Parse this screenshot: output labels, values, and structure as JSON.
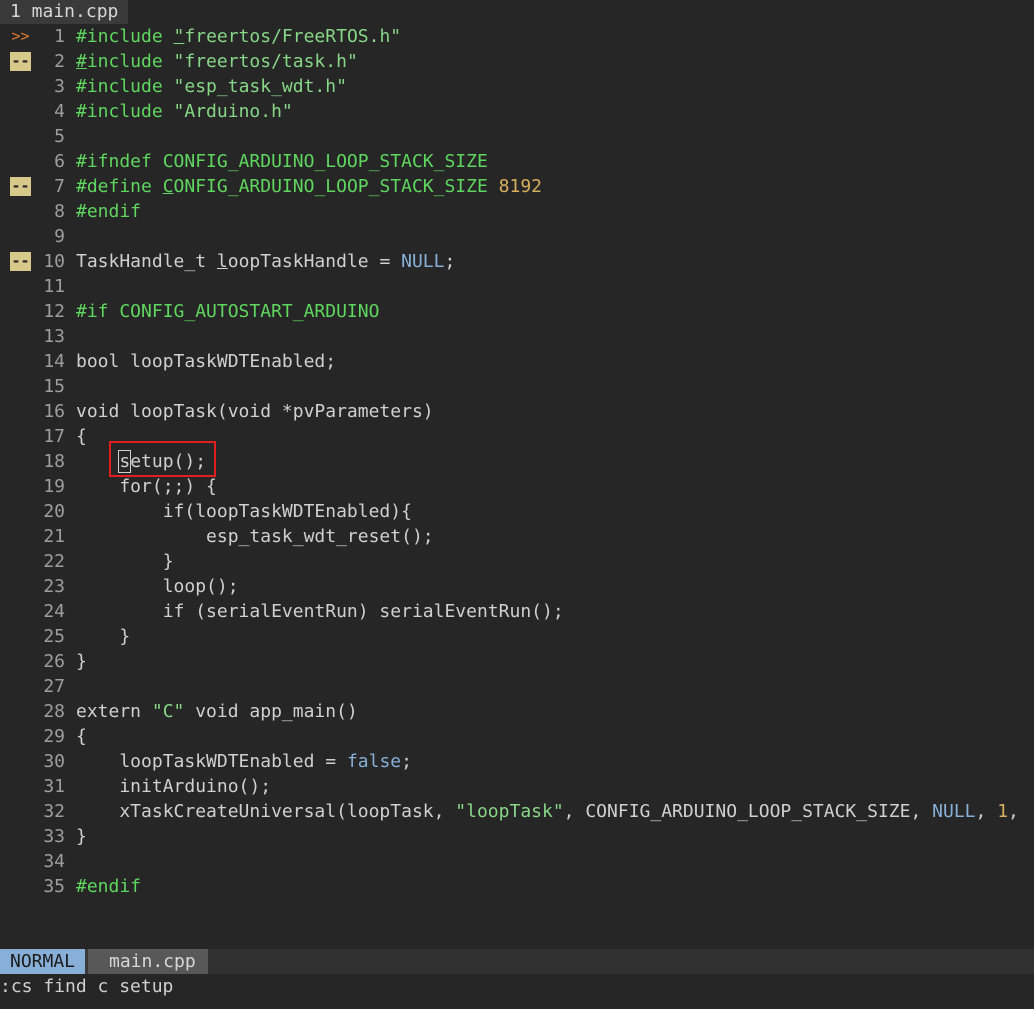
{
  "tabline": {
    "tab_label": "1 main.cpp"
  },
  "editor": {
    "lines": [
      {
        "num": "1",
        "sign": ">>",
        "sign_type": "arrow",
        "segments": [
          [
            "#include ",
            "c-pre"
          ],
          [
            "\"",
            "c-str u"
          ],
          [
            "freertos/FreeRTOS.h\"",
            "c-str"
          ]
        ]
      },
      {
        "num": "2",
        "sign": "--",
        "sign_type": "change",
        "segments": [
          [
            "#",
            "c-pre u"
          ],
          [
            "include ",
            "c-pre"
          ],
          [
            "\"freertos/task.h\"",
            "c-str"
          ]
        ]
      },
      {
        "num": "3",
        "sign": "",
        "sign_type": "",
        "segments": [
          [
            "#include ",
            "c-pre"
          ],
          [
            "\"esp_task_wdt.h\"",
            "c-str"
          ]
        ]
      },
      {
        "num": "4",
        "sign": "",
        "sign_type": "",
        "segments": [
          [
            "#include ",
            "c-pre"
          ],
          [
            "\"Arduino.h\"",
            "c-str"
          ]
        ]
      },
      {
        "num": "5",
        "sign": "",
        "sign_type": "",
        "segments": []
      },
      {
        "num": "6",
        "sign": "",
        "sign_type": "",
        "segments": [
          [
            "#ifndef CONFIG_ARDUINO_LOOP_STACK_SIZE",
            "c-pre"
          ]
        ]
      },
      {
        "num": "7",
        "sign": "--",
        "sign_type": "change",
        "segments": [
          [
            "#define ",
            "c-pre"
          ],
          [
            "C",
            "c-pre u"
          ],
          [
            "ONFIG_ARDUINO_LOOP_STACK_SIZE ",
            "c-pre"
          ],
          [
            "8192",
            "c-num"
          ]
        ]
      },
      {
        "num": "8",
        "sign": "",
        "sign_type": "",
        "segments": [
          [
            "#endif",
            "c-pre"
          ]
        ]
      },
      {
        "num": "9",
        "sign": "",
        "sign_type": "",
        "segments": []
      },
      {
        "num": "10",
        "sign": "--",
        "sign_type": "change",
        "segments": [
          [
            "TaskHandle_t ",
            ""
          ],
          [
            "l",
            "u"
          ],
          [
            "oopTaskHandle = ",
            ""
          ],
          [
            "NULL",
            "c-const"
          ],
          [
            ";",
            ""
          ]
        ]
      },
      {
        "num": "11",
        "sign": "",
        "sign_type": "",
        "segments": []
      },
      {
        "num": "12",
        "sign": "",
        "sign_type": "",
        "segments": [
          [
            "#if CONFIG_AUTOSTART_ARDUINO",
            "c-pre"
          ]
        ]
      },
      {
        "num": "13",
        "sign": "",
        "sign_type": "",
        "segments": []
      },
      {
        "num": "14",
        "sign": "",
        "sign_type": "",
        "segments": [
          [
            "bool loopTaskWDTEnabled;",
            ""
          ]
        ]
      },
      {
        "num": "15",
        "sign": "",
        "sign_type": "",
        "segments": []
      },
      {
        "num": "16",
        "sign": "",
        "sign_type": "",
        "segments": [
          [
            "void loopTask(void *pvParameters)",
            ""
          ]
        ]
      },
      {
        "num": "17",
        "sign": "",
        "sign_type": "",
        "segments": [
          [
            "{",
            ""
          ]
        ]
      },
      {
        "num": "18",
        "sign": "",
        "sign_type": "",
        "segments": [
          [
            "    ",
            ""
          ],
          [
            "s",
            "cursor"
          ],
          [
            "etup();",
            ""
          ]
        ]
      },
      {
        "num": "19",
        "sign": "",
        "sign_type": "",
        "segments": [
          [
            "    for(;;) {",
            ""
          ]
        ]
      },
      {
        "num": "20",
        "sign": "",
        "sign_type": "",
        "segments": [
          [
            "        if(loopTaskWDTEnabled){",
            ""
          ]
        ]
      },
      {
        "num": "21",
        "sign": "",
        "sign_type": "",
        "segments": [
          [
            "            esp_task_wdt_reset();",
            ""
          ]
        ]
      },
      {
        "num": "22",
        "sign": "",
        "sign_type": "",
        "segments": [
          [
            "        }",
            ""
          ]
        ]
      },
      {
        "num": "23",
        "sign": "",
        "sign_type": "",
        "segments": [
          [
            "        loop();",
            ""
          ]
        ]
      },
      {
        "num": "24",
        "sign": "",
        "sign_type": "",
        "segments": [
          [
            "        if (serialEventRun) serialEventRun();",
            ""
          ]
        ]
      },
      {
        "num": "25",
        "sign": "",
        "sign_type": "",
        "segments": [
          [
            "    }",
            ""
          ]
        ]
      },
      {
        "num": "26",
        "sign": "",
        "sign_type": "",
        "segments": [
          [
            "}",
            ""
          ]
        ]
      },
      {
        "num": "27",
        "sign": "",
        "sign_type": "",
        "segments": []
      },
      {
        "num": "28",
        "sign": "",
        "sign_type": "",
        "segments": [
          [
            "extern ",
            ""
          ],
          [
            "\"C\"",
            "c-str"
          ],
          [
            " void app_main()",
            ""
          ]
        ]
      },
      {
        "num": "29",
        "sign": "",
        "sign_type": "",
        "segments": [
          [
            "{",
            ""
          ]
        ]
      },
      {
        "num": "30",
        "sign": "",
        "sign_type": "",
        "segments": [
          [
            "    loopTaskWDTEnabled = ",
            ""
          ],
          [
            "false",
            "c-const"
          ],
          [
            ";",
            ""
          ]
        ]
      },
      {
        "num": "31",
        "sign": "",
        "sign_type": "",
        "segments": [
          [
            "    initArduino();",
            ""
          ]
        ]
      },
      {
        "num": "32",
        "sign": "",
        "sign_type": "",
        "segments": [
          [
            "    xTaskCreateUniversal(loopTask, ",
            ""
          ],
          [
            "\"loopTask\"",
            "c-str"
          ],
          [
            ", CONFIG_ARDUINO_LOOP_STACK_SIZE, ",
            ""
          ],
          [
            "NULL",
            "c-const"
          ],
          [
            ", ",
            ""
          ],
          [
            "1",
            "c-num"
          ],
          [
            ",",
            ""
          ]
        ]
      },
      {
        "num": "33",
        "sign": "",
        "sign_type": "",
        "segments": [
          [
            "}",
            ""
          ]
        ]
      },
      {
        "num": "34",
        "sign": "",
        "sign_type": "",
        "segments": []
      },
      {
        "num": "35",
        "sign": "",
        "sign_type": "",
        "segments": [
          [
            "#endif",
            "c-pre"
          ]
        ]
      }
    ]
  },
  "statusline": {
    "mode": "NORMAL",
    "filename": "main.cpp"
  },
  "cmdline": {
    "text": ":cs find c setup"
  }
}
